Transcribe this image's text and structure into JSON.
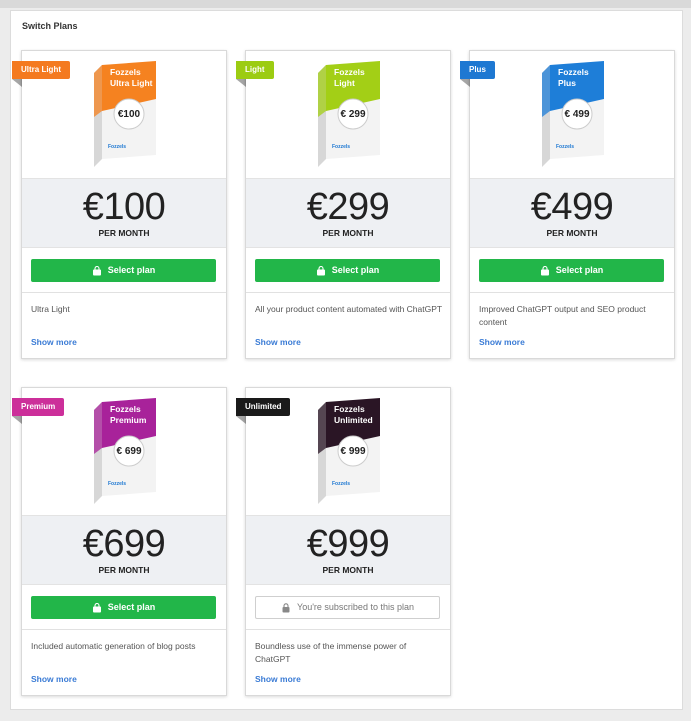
{
  "panel": {
    "title": "Switch Plans"
  },
  "plans": [
    {
      "ribbon": "Ultra Light",
      "ribbon_color": "#f47a20",
      "box_brand": "Fozzels",
      "box_name": "Ultra Light",
      "box_price": "€100",
      "box_color": "#f58220",
      "price": "€100",
      "period": "PER MONTH",
      "button": "Select plan",
      "button_state": "select",
      "description": "Ultra Light",
      "more": "Show more"
    },
    {
      "ribbon": "Light",
      "ribbon_color": "#9ccc12",
      "box_brand": "Fozzels",
      "box_name": "Light",
      "box_price": "€ 299",
      "box_color": "#a3cf16",
      "price": "€299",
      "period": "PER MONTH",
      "button": "Select plan",
      "button_state": "select",
      "description": "All your product content automated with ChatGPT",
      "more": "Show more"
    },
    {
      "ribbon": "Plus",
      "ribbon_color": "#1e78d2",
      "box_brand": "Fozzels",
      "box_name": "Plus",
      "box_price": "€ 499",
      "box_color": "#1e7ed8",
      "price": "€499",
      "period": "PER MONTH",
      "button": "Select plan",
      "button_state": "select",
      "description": "Improved ChatGPT output and SEO product content",
      "more": "Show more"
    },
    {
      "ribbon": "Premium",
      "ribbon_color": "#cc2f9a",
      "box_brand": "Fozzels",
      "box_name": "Premium",
      "box_price": "€ 699",
      "box_color": "#a8229a",
      "price": "€699",
      "period": "PER MONTH",
      "button": "Select plan",
      "button_state": "select",
      "description": "Included automatic generation of blog posts",
      "more": "Show more"
    },
    {
      "ribbon": "Unlimited",
      "ribbon_color": "#1a1a1a",
      "box_brand": "Fozzels",
      "box_name": "Unlimited",
      "box_price": "€ 999",
      "box_color": "#2a1525",
      "price": "€999",
      "period": "PER MONTH",
      "button": "You're subscribed to this plan",
      "button_state": "subscribed",
      "description": "Boundless use of the immense power of ChatGPT",
      "more": "Show more"
    }
  ],
  "icons": {
    "select": "bag-icon",
    "subscribed": "lock-icon"
  }
}
